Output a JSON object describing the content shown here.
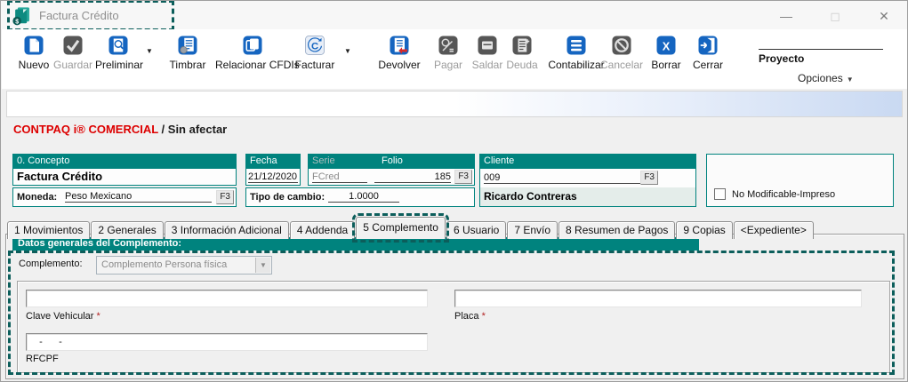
{
  "window": {
    "title": "Factura Crédito",
    "controls": {
      "minimize": "—",
      "maximize": "◻",
      "close": "✕"
    }
  },
  "toolbar": {
    "buttons": [
      {
        "label": "Nuevo"
      },
      {
        "label": "Guardar"
      },
      {
        "label": "Preliminar"
      },
      {
        "label": "Timbrar"
      },
      {
        "label": "Relacionar CFDIs"
      },
      {
        "label": "Facturar"
      },
      {
        "label": "Devolver"
      },
      {
        "label": "Pagar"
      },
      {
        "label": "Saldar"
      },
      {
        "label": "Deuda"
      },
      {
        "label": "Contabilizar"
      },
      {
        "label": "Cancelar"
      },
      {
        "label": "Borrar"
      },
      {
        "label": "Cerrar"
      }
    ],
    "proyecto_label": "Proyecto",
    "opciones_label": "Opciones",
    "dropdown_caret": "▼"
  },
  "status_bar": {
    "brand": "CONTPAQ i® COMERCIAL",
    "mode": " / Sin afectar"
  },
  "document": {
    "concepto": {
      "header": "0. Concepto",
      "value": "Factura Crédito"
    },
    "moneda": {
      "label": "Moneda:",
      "value": "Peso Mexicano",
      "f3": "F3"
    },
    "fecha": {
      "header": "Fecha",
      "value": "21/12/2020"
    },
    "serie": {
      "header": "Serie",
      "value": "FCred"
    },
    "folio": {
      "header": "Folio",
      "value": "185",
      "f3": "F3"
    },
    "tipo_cambio": {
      "label": "Tipo de cambio:",
      "value": "1.0000"
    },
    "cliente": {
      "header": "Cliente",
      "code": "009",
      "f3": "F3",
      "name": "Ricardo Contreras"
    },
    "no_modificable": {
      "label": "No Modificable-Impreso",
      "checked": false
    }
  },
  "tabs": [
    {
      "label": "1 Movimientos",
      "active": false
    },
    {
      "label": "2 Generales",
      "active": false
    },
    {
      "label": "3 Información Adicional",
      "active": false
    },
    {
      "label": "4 Addenda",
      "active": false
    },
    {
      "label": "5 Complemento",
      "active": true
    },
    {
      "label": "6 Usuario",
      "active": false
    },
    {
      "label": "7 Envío",
      "active": false
    },
    {
      "label": "8 Resumen de Pagos",
      "active": false
    },
    {
      "label": "9 Copias",
      "active": false
    },
    {
      "label": "<Expediente>",
      "active": false
    }
  ],
  "complemento": {
    "section_title": "Datos generales del Complemento:",
    "selector_label": "Complemento:",
    "selector_value": "Complemento Persona física",
    "fields": {
      "clave_vehicular": {
        "label": "Clave Vehicular",
        "required_mark": "*",
        "value": ""
      },
      "placa": {
        "label": "Placa",
        "required_mark": "*",
        "value": ""
      },
      "rfcpf": {
        "label": "RFCPF",
        "value": "   -      -"
      }
    }
  },
  "colors": {
    "accent_teal": "#00837e",
    "annotation_teal": "#0c5e5b",
    "icon_blue": "#1565c0",
    "brand_red": "#dd0000",
    "band_gradient_blue": "#c9d9f2"
  }
}
